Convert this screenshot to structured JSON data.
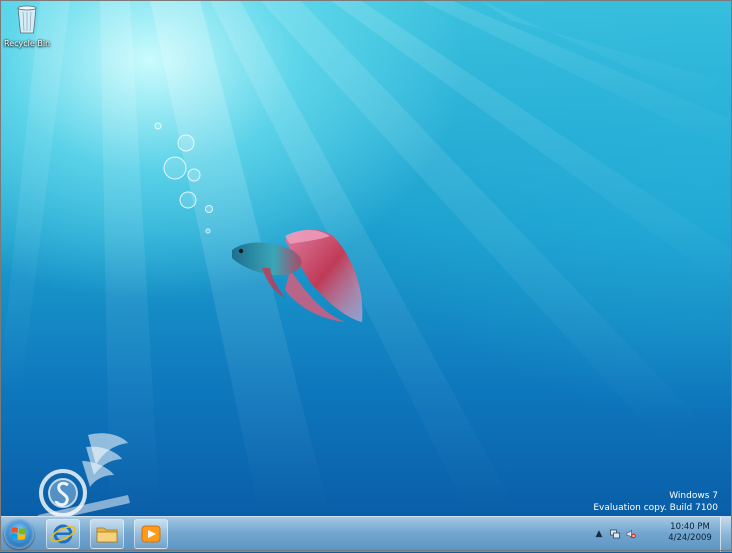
{
  "desktop": {
    "icons": [
      {
        "label": "Recycle Bin",
        "icon": "recycle-bin-icon"
      }
    ],
    "watermark": {
      "line1": "Windows 7",
      "line2": "Evaluation copy. Build 7100"
    }
  },
  "taskbar": {
    "start_icon": "windows-logo-icon",
    "pinned": [
      {
        "icon": "internet-explorer-icon"
      },
      {
        "icon": "windows-explorer-folder-icon"
      },
      {
        "icon": "media-player-icon"
      }
    ],
    "tray": {
      "icons": [
        "show-hidden-icons-arrow",
        "network-icon",
        "volume-muted-icon"
      ],
      "time": "10:40 PM",
      "date": "4/24/2009"
    }
  },
  "colors": {
    "accent": "#1c9fce",
    "taskbar": "#78aad2"
  }
}
